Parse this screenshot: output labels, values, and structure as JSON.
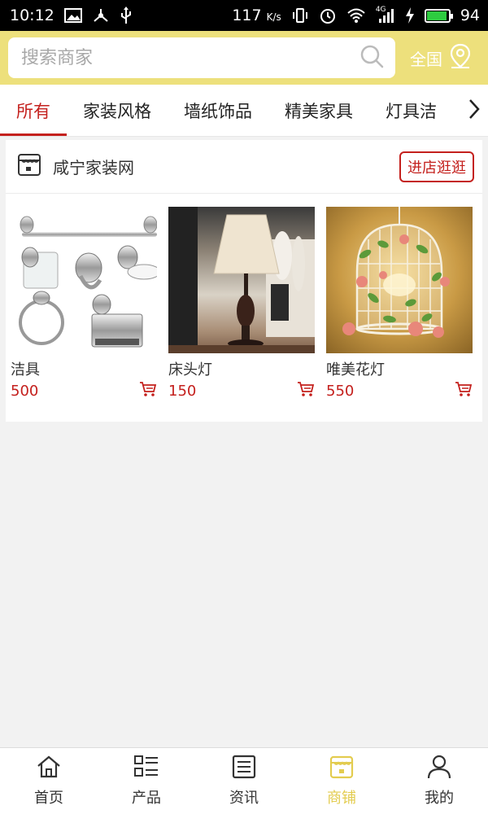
{
  "status_bar": {
    "time": "10:12",
    "speed": "117",
    "speed_unit": "K/s",
    "battery": "94",
    "network": "4G"
  },
  "search": {
    "placeholder": "搜索商家",
    "region_label": "全国"
  },
  "tabs": [
    {
      "label": "所有",
      "active": true
    },
    {
      "label": "家装风格",
      "active": false
    },
    {
      "label": "墙纸饰品",
      "active": false
    },
    {
      "label": "精美家具",
      "active": false
    },
    {
      "label": "灯具洁",
      "active": false
    }
  ],
  "shop": {
    "name": "咸宁家装网",
    "visit_label": "进店逛逛",
    "products": [
      {
        "name": "洁具",
        "price": "500",
        "image": "bathroom-fixtures"
      },
      {
        "name": "床头灯",
        "price": "150",
        "image": "bedside-lamp"
      },
      {
        "name": "唯美花灯",
        "price": "550",
        "image": "floral-lamp"
      }
    ]
  },
  "bottom_nav": [
    {
      "label": "首页",
      "icon": "home-icon",
      "active": false
    },
    {
      "label": "产品",
      "icon": "list-icon",
      "active": false
    },
    {
      "label": "资讯",
      "icon": "news-icon",
      "active": false
    },
    {
      "label": "商铺",
      "icon": "store-icon",
      "active": true
    },
    {
      "label": "我的",
      "icon": "user-icon",
      "active": false
    }
  ],
  "colors": {
    "accent_red": "#c4201d",
    "header_yellow": "#ede07c",
    "nav_active": "#e3cc4f"
  }
}
